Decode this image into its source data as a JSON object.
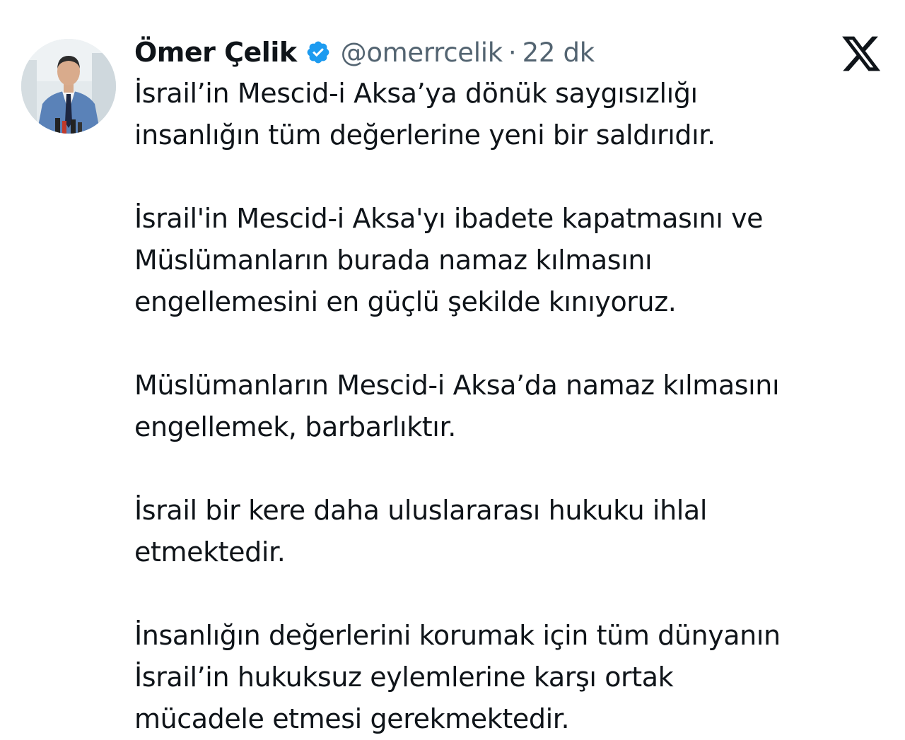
{
  "author": {
    "display_name": "Ömer Çelik",
    "handle": "@omerrcelik",
    "separator": "·",
    "timestamp": "22 dk",
    "verified_badge_color": "#1d9bf0",
    "avatar_icon": "profile-photo-man-in-blue-suit"
  },
  "platform": {
    "logo_icon": "x-logo"
  },
  "tweet": {
    "paragraphs": [
      [
        "İsrail’in Mescid-i Aksa’ya dönük saygısızlığı",
        "insanlığın tüm değerlerine yeni bir saldırıdır."
      ],
      [
        "İsrail'in Mescid-i Aksa'yı ibadete kapatmasını ve",
        "Müslümanların burada namaz kılmasını",
        "engellemesini en güçlü şekilde kınıyoruz."
      ],
      [
        "Müslümanların Mescid-i Aksa’da namaz kılmasını",
        "engellemek, barbarlıktır."
      ],
      [
        "İsrail bir kere daha uluslararası hukuku ihlal",
        "etmektedir."
      ],
      [
        "İnsanlığın değerlerini korumak için tüm dünyanın",
        "İsrail’in hukuksuz eylemlerine karşı ortak",
        "mücadele etmesi gerekmektedir."
      ]
    ]
  }
}
